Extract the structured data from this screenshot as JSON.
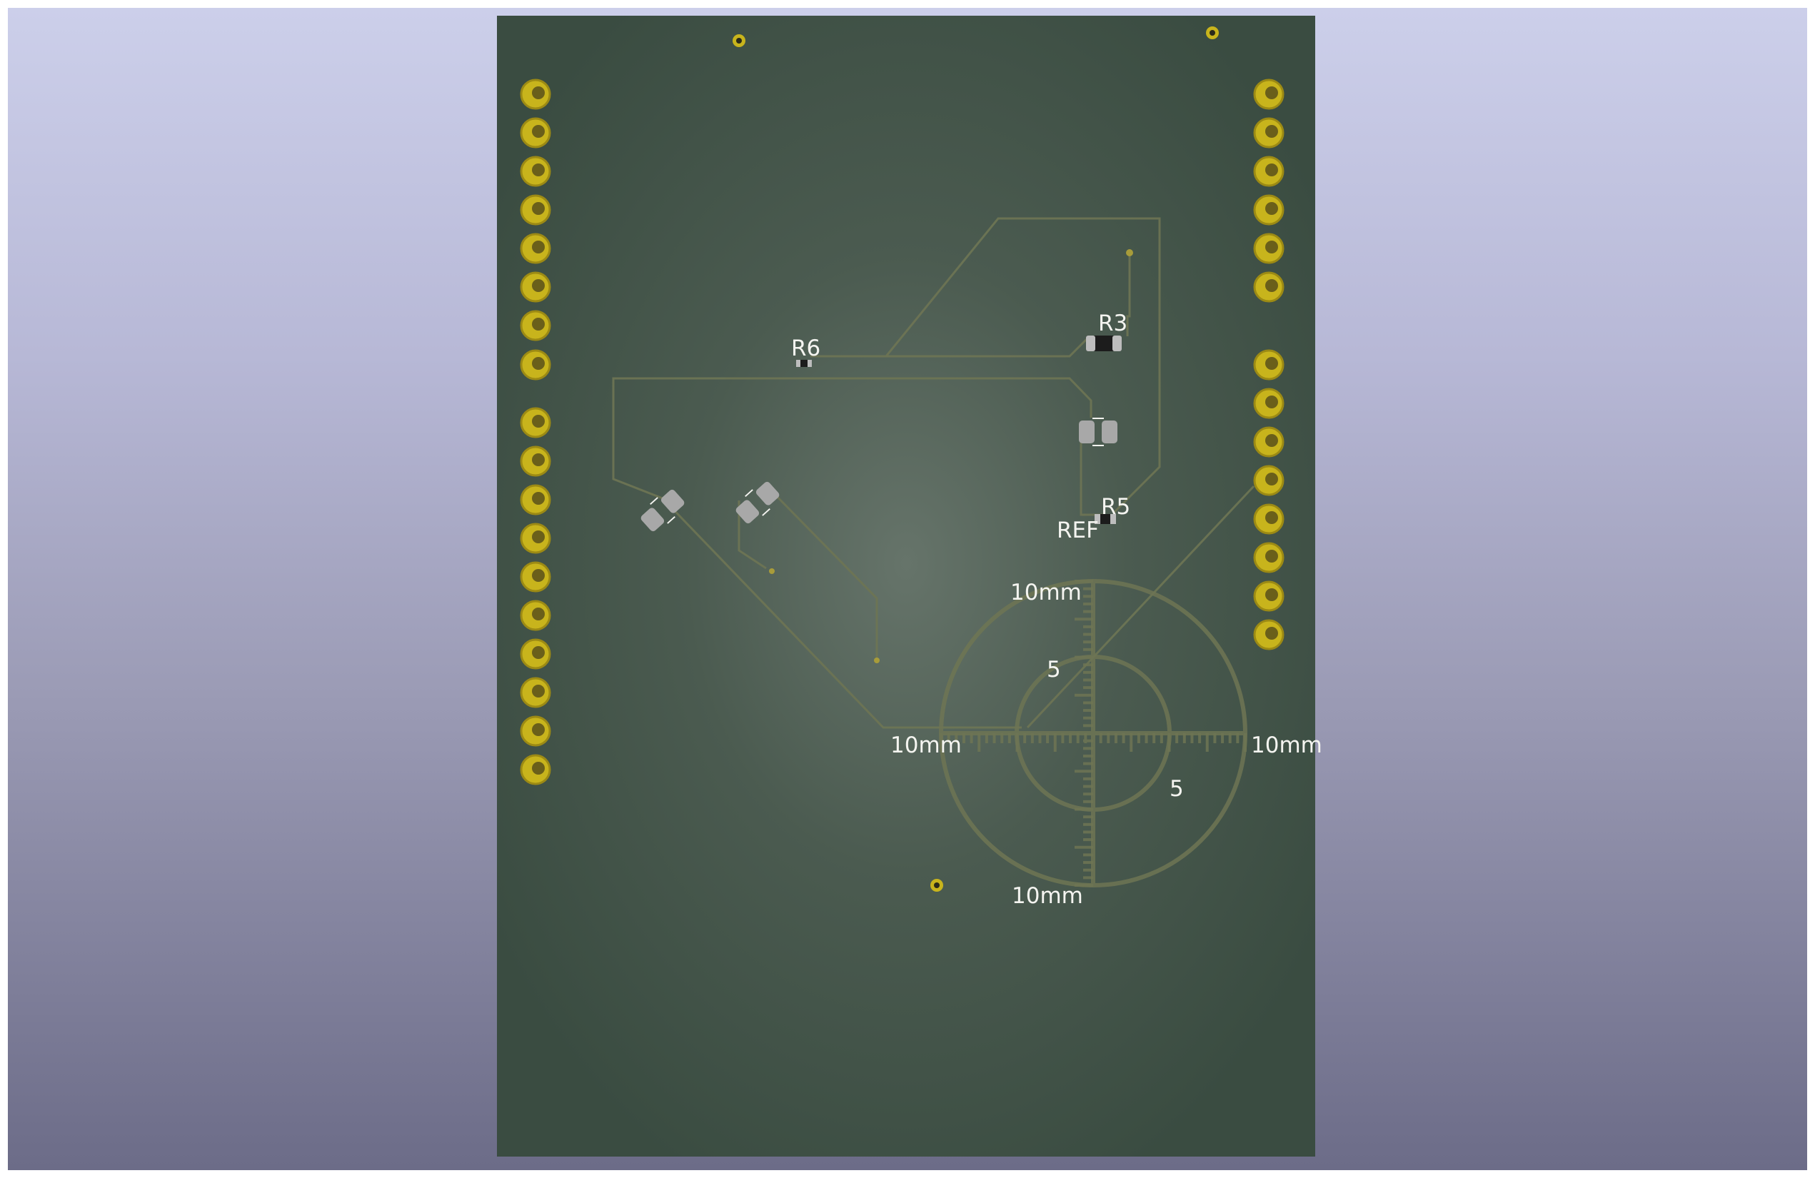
{
  "app": {
    "view": "3D Viewer"
  },
  "colors": {
    "background_top": "#cccfea",
    "background_bottom": "#6c6c88",
    "board": "#3f5246",
    "pad_gold": "#c8b41c",
    "trace": "#6e7554",
    "silkscreen": "#f4f4f0",
    "smd_pad": "#a8a8a8"
  },
  "board": {
    "references": {
      "r6": "R6",
      "r3": "R3",
      "r5": "R5",
      "ref": "REF"
    },
    "target_labels": {
      "top": "10mm",
      "left": "10mm",
      "right": "10mm",
      "bottom": "10mm",
      "inner_left": "5",
      "inner_bottom": "5"
    },
    "header_left_pins": 18,
    "header_right_pins": 14
  }
}
